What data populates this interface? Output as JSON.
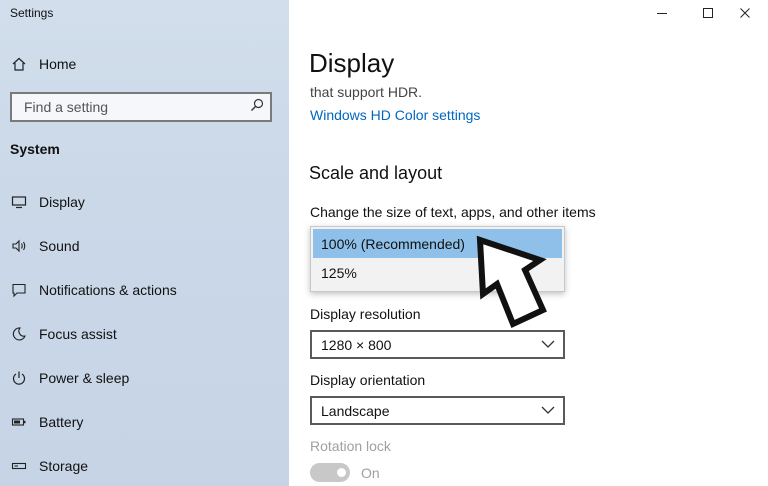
{
  "window": {
    "title": "Settings",
    "controls": [
      "minimize",
      "maximize",
      "close"
    ]
  },
  "sidebar": {
    "home_label": "Home",
    "search_placeholder": "Find a setting",
    "section_label": "System",
    "items": [
      {
        "label": "Display",
        "icon": "monitor-icon"
      },
      {
        "label": "Sound",
        "icon": "speaker-icon"
      },
      {
        "label": "Notifications & actions",
        "icon": "notification-icon"
      },
      {
        "label": "Focus assist",
        "icon": "moon-icon"
      },
      {
        "label": "Power & sleep",
        "icon": "power-icon"
      },
      {
        "label": "Battery",
        "icon": "battery-icon"
      },
      {
        "label": "Storage",
        "icon": "storage-icon"
      }
    ]
  },
  "main": {
    "page_title": "Display",
    "hdr_text": "that support HDR.",
    "hdr_link": "Windows HD Color settings",
    "scale_section_title": "Scale and layout",
    "scale_label": "Change the size of text, apps, and other items",
    "scale_options": [
      "100% (Recommended)",
      "125%"
    ],
    "scale_selected": "100% (Recommended)",
    "resolution_label": "Display resolution",
    "resolution_value": "1280 × 800",
    "orientation_label": "Display orientation",
    "orientation_value": "Landscape",
    "rotation_lock_label": "Rotation lock",
    "rotation_lock_state": "On"
  },
  "colors": {
    "accent": "#0067c0",
    "selected_item": "#8ec0ea",
    "sidebar_bg": "#cad8e8"
  }
}
